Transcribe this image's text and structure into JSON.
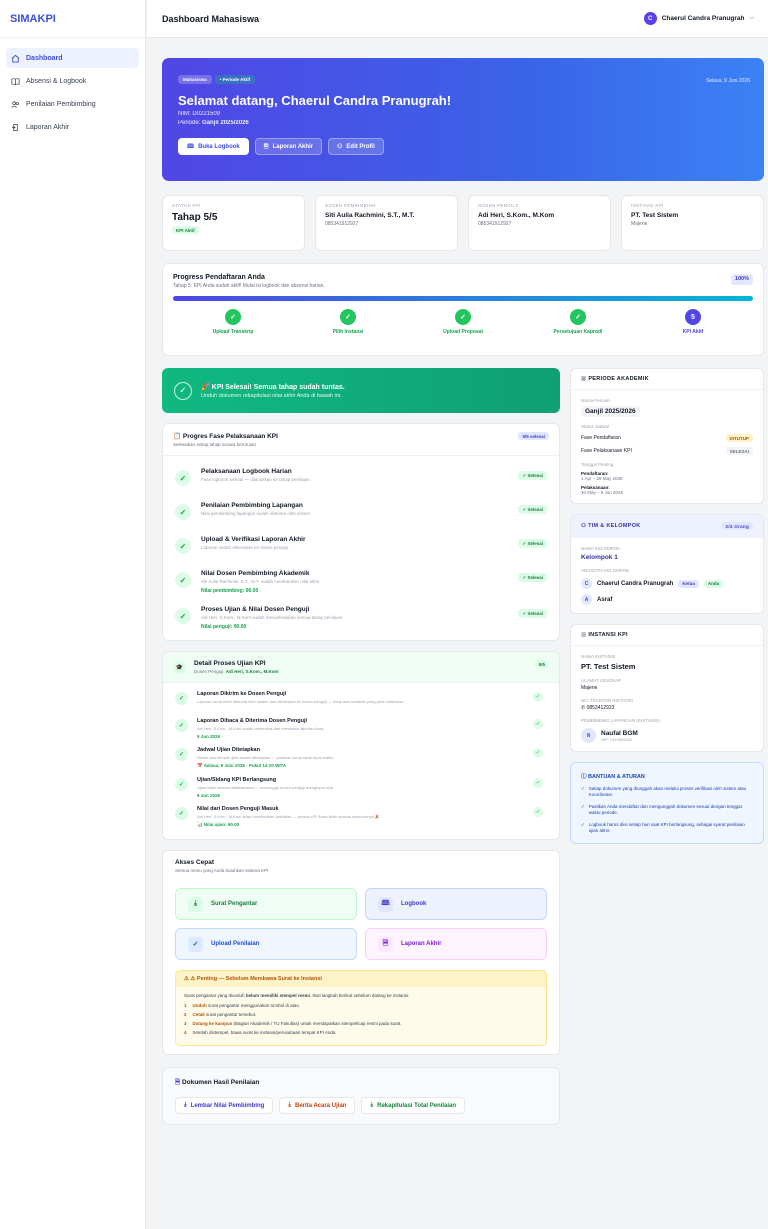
{
  "app": {
    "brand": "SIMAKPI"
  },
  "sidebar": {
    "items": [
      {
        "label": "Dashboard",
        "icon": "home-icon"
      },
      {
        "label": "Absensi & Logbook",
        "icon": "book-icon"
      },
      {
        "label": "Penilaian Pembimbing",
        "icon": "users-icon"
      },
      {
        "label": "Laporan Akhir",
        "icon": "upload-icon"
      }
    ]
  },
  "header": {
    "title": "Dashboard Mahasiswa",
    "user_name": "Chaerul Candra Pranugrah",
    "user_initial": "C"
  },
  "hero": {
    "badges": [
      "Mahasiswa",
      "• Periode Aktif"
    ],
    "date": "Selasa, 9 Juni 2026",
    "greeting": "Selamat datang, Chaerul Candra Pranugrah!",
    "nim": "NIM: D0221509",
    "periode_label": "Periode:",
    "periode_value": "Ganjil 2025/2026",
    "buttons": [
      "Buka Logbook",
      "Laporan Akhir",
      "Edit Profil"
    ]
  },
  "stats": [
    {
      "label": "STATUS KPI",
      "value": "Tahap 5/5",
      "badge": "KPI Aktif"
    },
    {
      "label": "DOSEN PEMBIMBING",
      "value": "Siti Aulia Rachmini, S.T., M.T.",
      "sub": "085341912927"
    },
    {
      "label": "DOSEN PENGUJI",
      "value": "Adi Heri, S.Kom., M.Kom",
      "sub": "085341912927"
    },
    {
      "label": "INSTANSI KPI",
      "value": "PT. Test Sistem",
      "sub": "Majene"
    }
  ],
  "progress": {
    "title": "Progress Pendaftaran Anda",
    "subtitle": "Tahap 5: KPI Anda sudah aktif! Mulai isi logbook dan absensi harian.",
    "percent_label": "100%",
    "percent": 100,
    "steps": [
      "Upload Transkrip",
      "Pilih Instansi",
      "Upload Proposal",
      "Persetujuan Kaprodi",
      "KPI Aktif"
    ],
    "last_step_number": "5"
  },
  "done_banner": {
    "title": "🎉 KPI Selesai! Semua tahap sudah tuntas.",
    "subtitle": "Unduh dokumen rekapitulasi nilai akhir Anda di bawah ini."
  },
  "phases": {
    "title": "Progres Fase Pelaksanaan KPI",
    "subtitle": "Selesaikan setiap tahap secara berurutan",
    "badge": "5/5 selesai",
    "items": [
      {
        "title": "Pelaksanaan Logbook Harian",
        "desc": "Fase logbook selesai — dilanjutkan ke tahap penilaian",
        "extra": "",
        "status": "✓ Selesai"
      },
      {
        "title": "Penilaian Pembimbing Lapangan",
        "desc": "Nilai pembimbing lapangan sudah diterima oleh sistem",
        "extra": "",
        "status": "✓ Selesai"
      },
      {
        "title": "Upload & Verifikasi Laporan Akhir",
        "desc": "Laporan sudah diteruskan ke dosen penguji",
        "extra": "",
        "status": "✓ Selesai"
      },
      {
        "title": "Nilai Dosen Pembimbing Akademik",
        "desc": "Siti Aulia Rachmini, S.T., M.T. sudah memberikan nilai akhir",
        "extra": "Nilai pembimbing: 90.00",
        "status": "✓ Selesai"
      },
      {
        "title": "Proses Ujian & Nilai Dosen Penguji",
        "desc": "Adi Heri, S.Kom., M.Kom sudah menyelesaikan semua tahap penilaian",
        "extra": "Nilai penguji: 90.00",
        "status": "✓ Selesai"
      }
    ]
  },
  "exam": {
    "title": "Detail Proses Ujian KPI",
    "subtitle_label": "Dosen Penguji:",
    "subtitle_value": "Adi Heri, S.Kom., M.Kom",
    "badge": "5/5",
    "items": [
      {
        "title": "Laporan Dikirim ke Dosen Penguji",
        "desc": "Laporan Anda telah diterima oleh sistem dan diteruskan ke dosen penguji — tidak ada tindakan yang perlu dilakukan",
        "extra": ""
      },
      {
        "title": "Laporan Dibaca & Diterima Dosen Penguji",
        "desc": "Adi Heri, S.Kom., M.Kom sudah menerima dan membaca laporan Anda",
        "extra": "9 Jun 2026"
      },
      {
        "title": "Jadwal Ujian Ditetapkan",
        "desc": "Waktu dan tempat ujian sudah ditetapkan — pastikan Anda hadir tepat waktu",
        "extra": "📅 Selasa, 9 Juni 2026 · Pukul 14:20 WITA"
      },
      {
        "title": "Ujian/Sidang KPI Berlangsung",
        "desc": "Ujian telah selesai dilaksanakan — menunggu dosen penguji menginput nilai",
        "extra": "9 Jun 2026"
      },
      {
        "title": "Nilai dari Dosen Penguji Masuk",
        "desc": "Adi Heri, S.Kom., M.Kom telah memberikan penilaian — proses KPI Anda telah selesai sepenuhnya 🎉",
        "extra": "📊 Nilai ujian: 90.00"
      }
    ]
  },
  "quick": {
    "title": "Akses Cepat",
    "subtitle": "Semua menu yang Anda butuhkan selama KPI",
    "buttons": [
      "Surat Pengantar",
      "Logbook",
      "Upload Penilaian",
      "Laporan Akhir"
    ],
    "warning": {
      "title": "⚠ Penting — Sebelum Membawa Surat ke Instansi",
      "intro_a": "Surat pengantar yang diunduh",
      "intro_b": "belum memiliki stempel resmi",
      "intro_c": ". Ikuti langkah berikut sebelum datang ke instansi:",
      "steps": [
        {
          "n": "1",
          "bold": "Unduh",
          "text": " surat pengantar menggunakan tombol di atas."
        },
        {
          "n": "2",
          "bold": "Cetak",
          "text": " surat pengantar tersebut."
        },
        {
          "n": "3",
          "bold": "Datang ke kampus",
          "text": " (Bagian Akademik / TU Fakultas) untuk mendapatkan stempel/cap resmi pada surat."
        },
        {
          "n": "4",
          "bold": "",
          "text": "Setelah distempel, bawa surat ke instansi/perusahaan tempat KPI Anda."
        }
      ]
    }
  },
  "documents": {
    "title": "Dokumen Hasil Penilaian",
    "buttons": [
      "Lembar Nilai Pembimbing",
      "Berita Acara Ujian",
      "Rekapitulasi Total Penilaian"
    ]
  },
  "periode": {
    "title": "PERIODE AKADEMIK",
    "name_label": "Nama Periode",
    "name": "Ganjil 2025/2026",
    "status_label": "Status Jadwal",
    "rows": [
      {
        "label": "Fase Pendaftaran",
        "badge": "DITUTUP"
      },
      {
        "label": "Fase Pelaksanaan KPI",
        "badge": "SELESAI"
      }
    ],
    "dates_label": "Tanggal Penting",
    "dates": [
      {
        "label": "Pendaftaran:",
        "value": "1 Apr – 28 May 2026"
      },
      {
        "label": "Pelaksanaan:",
        "value": "30 May – 8 Jun 2026"
      }
    ]
  },
  "team": {
    "title": "TIM & KELOMPOK",
    "badge": "2/4 Orang",
    "group_label": "NAMA KELOMPOK",
    "group": "Kelompok 1",
    "members_label": "ANGGOTA KELOMPOK",
    "members": [
      {
        "initial": "C",
        "name": "Chaerul Candra Pranugrah",
        "tags": [
          "Ketua",
          "Anda"
        ]
      },
      {
        "initial": "A",
        "name": "Asraf",
        "tags": []
      }
    ]
  },
  "instansi": {
    "title": "INSTANSI KPI",
    "name_label": "NAMA INSTANSI",
    "name": "PT. Test Sistem",
    "addr_label": "ALAMAT LENGKAP",
    "addr": "Majene",
    "phone_label": "NO. TELEPON INSTANSI",
    "phone": "0853412923",
    "mentor_label": "PEMBIMBING LAPANGAN (INSTANSI)",
    "mentor_initial": "N",
    "mentor": "Naufal BGM",
    "mentor_nip": "NIP: 1344565432"
  },
  "help": {
    "title": "BANTUAN & ATURAN",
    "items": [
      "Setiap dokumen yang diunggah akan melalui proses verifikasi oleh sistem atau Koordinator.",
      "Pastikan Anda mendaftar dan mengunggah dokumen sesuai dengan tenggat waktu periode.",
      "Logbook harus diisi setiap hari saat KPI berlangsung, sebagai syarat penilaian ujian akhir."
    ]
  }
}
